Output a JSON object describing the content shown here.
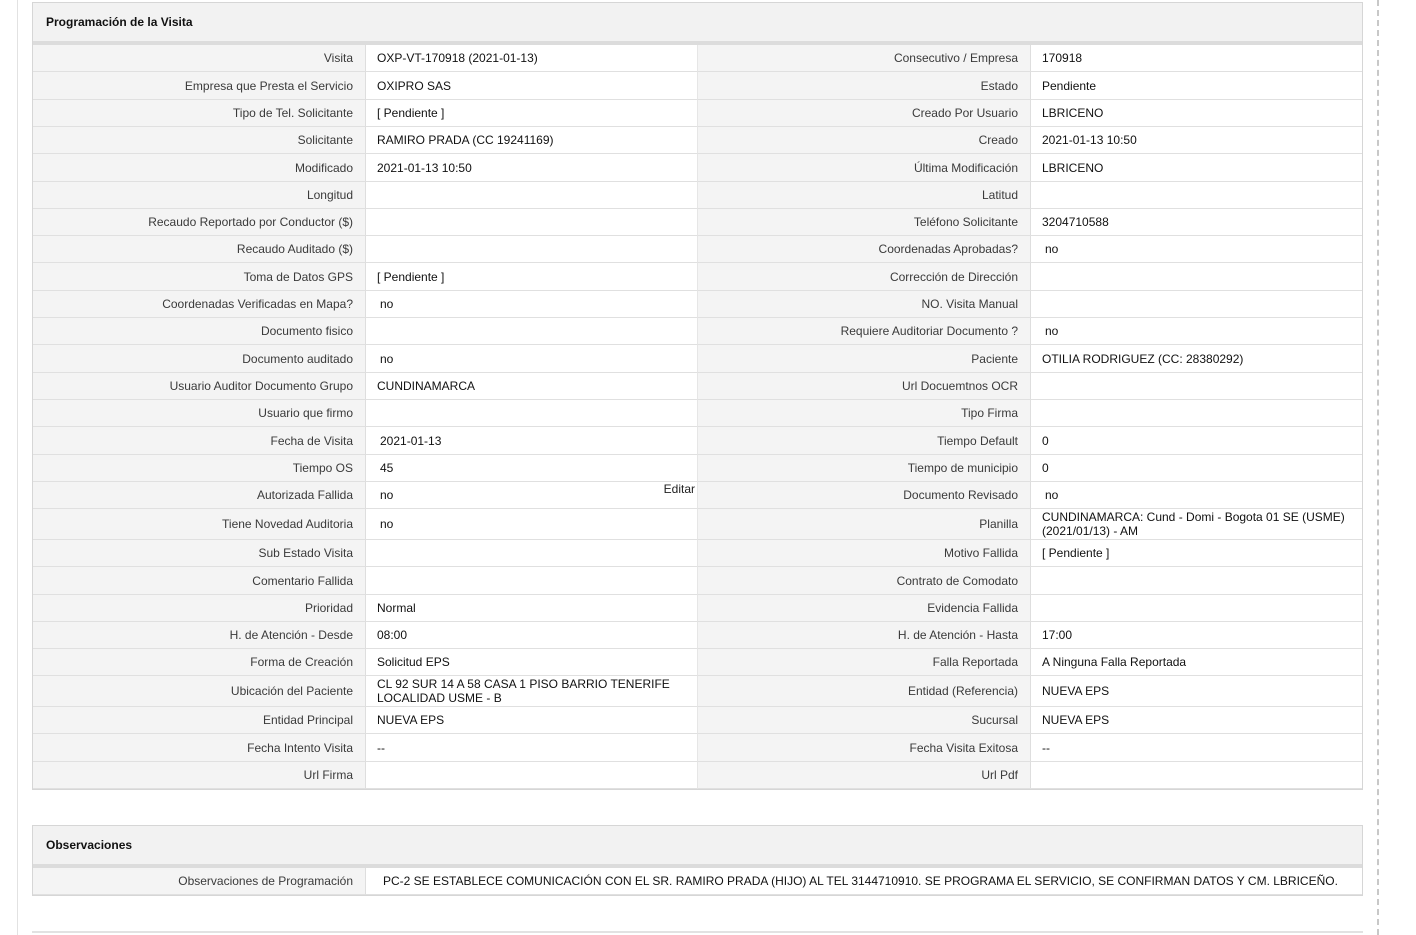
{
  "programacion": {
    "title": "Programación de la Visita",
    "rows": [
      {
        "l1": "Visita",
        "v1": "OXP-VT-170918 (2021-01-13)",
        "l2": "Consecutivo / Empresa",
        "v2": "170918"
      },
      {
        "l1": "Empresa que Presta el Servicio",
        "v1": "OXIPRO SAS",
        "l2": "Estado",
        "v2": "Pendiente"
      },
      {
        "l1": "Tipo de Tel. Solicitante",
        "v1": "[ Pendiente ]",
        "l2": "Creado Por Usuario",
        "v2": "LBRICENO"
      },
      {
        "l1": "Solicitante",
        "v1": "RAMIRO PRADA (CC 19241169)",
        "l2": "Creado",
        "v2": "2021-01-13 10:50"
      },
      {
        "l1": "Modificado",
        "v1": "2021-01-13 10:50",
        "l2": "Última Modificación",
        "v2": "LBRICENO"
      },
      {
        "l1": "Longitud",
        "v1": "",
        "l2": "Latitud",
        "v2": ""
      },
      {
        "l1": "Recaudo Reportado por Conductor ($)",
        "v1": "",
        "l2": "Teléfono Solicitante",
        "v2": "3204710588"
      },
      {
        "l1": "Recaudo Auditado ($)",
        "v1": "",
        "l2": "Coordenadas Aprobadas?",
        "v2": "no"
      },
      {
        "l1": "Toma de Datos GPS",
        "v1": "[ Pendiente ]",
        "l2": "Corrección de Dirección",
        "v2": ""
      },
      {
        "l1": "Coordenadas Verificadas en Mapa?",
        "v1": "no",
        "l2": "NO. Visita Manual",
        "v2": ""
      },
      {
        "l1": "Documento fisico",
        "v1": "",
        "l2": "Requiere Auditoriar Documento ?",
        "v2": "no"
      },
      {
        "l1": "Documento auditado",
        "v1": "no",
        "l2": "Paciente",
        "v2": "OTILIA RODRIGUEZ (CC: 28380292)"
      },
      {
        "l1": "Usuario Auditor Documento Grupo",
        "v1": "CUNDINAMARCA",
        "l2": "Url Docuemtnos OCR",
        "v2": ""
      },
      {
        "l1": "Usuario que firmo",
        "v1": "",
        "l2": "Tipo Firma",
        "v2": ""
      },
      {
        "l1": "Fecha de Visita",
        "v1": "2021-01-13",
        "l2": "Tiempo Default",
        "v2": "0"
      },
      {
        "l1": "Tiempo OS",
        "v1": "45",
        "l2": "Tiempo de municipio",
        "v2": "0"
      },
      {
        "l1": "Autorizada Fallida",
        "v1": "no",
        "l2": "Documento Revisado",
        "v2": "no"
      },
      {
        "l1": "Tiene Novedad Auditoria",
        "v1": "no",
        "l2": "Planilla",
        "v2": "CUNDINAMARCA: Cund - Domi - Bogota 01 SE (USME) (2021/01/13) - AM"
      },
      {
        "l1": "Sub Estado Visita",
        "v1": "",
        "l2": "Motivo Fallida",
        "v2": "[ Pendiente ]"
      },
      {
        "l1": "Comentario Fallida",
        "v1": "",
        "l2": "Contrato de Comodato",
        "v2": ""
      },
      {
        "l1": "Prioridad",
        "v1": "Normal",
        "l2": "Evidencia Fallida",
        "v2": ""
      },
      {
        "l1": "H. de Atención - Desde",
        "v1": "08:00",
        "l2": "H. de Atención - Hasta",
        "v2": "17:00"
      },
      {
        "l1": "Forma de Creación",
        "v1": "Solicitud EPS",
        "l2": "Falla Reportada",
        "v2": "A Ninguna Falla Reportada"
      },
      {
        "l1": "Ubicación del Paciente",
        "v1": "CL 92 SUR 14 A 58 CASA 1 PISO BARRIO TENERIFE LOCALIDAD USME - B",
        "l2": "Entidad (Referencia)",
        "v2": "NUEVA EPS"
      },
      {
        "l1": "Entidad Principal",
        "v1": "NUEVA EPS",
        "l2": "Sucursal",
        "v2": "NUEVA EPS"
      },
      {
        "l1": "Fecha Intento Visita",
        "v1": "--",
        "l2": "Fecha Visita Exitosa",
        "v2": "--"
      },
      {
        "l1": "Url Firma",
        "v1": "",
        "l2": "Url Pdf",
        "v2": ""
      }
    ],
    "edit_link": "Editar"
  },
  "observaciones": {
    "title": "Observaciones",
    "label": "Observaciones de Programación",
    "value": "PC-2 SE ESTABLECE COMUNICACIÓN CON EL SR. RAMIRO PRADA (HIJO) AL TEL 3144710910. SE PROGRAMA EL SERVICIO, SE CONFIRMAN DATOS Y CM. LBRICEÑO."
  }
}
